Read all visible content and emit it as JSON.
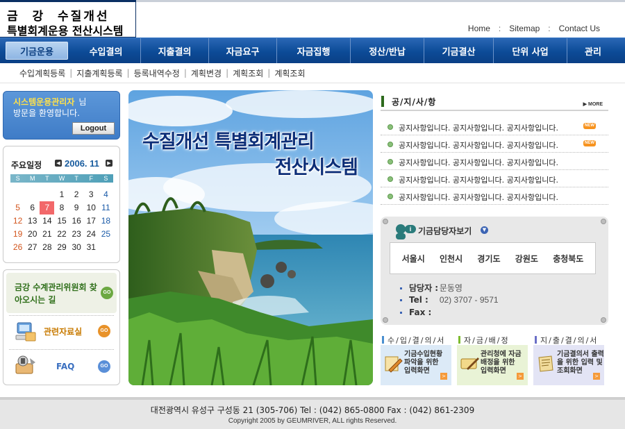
{
  "header": {
    "logo_line1": "금  강  수질개선",
    "logo_line2": "특별회계운용 전산시스템",
    "links": [
      "Home",
      "Sitemap",
      "Contact Us"
    ],
    "link_separator": ":"
  },
  "main_nav": {
    "items": [
      "기금운용",
      "수입결의",
      "지출결의",
      "자금요구",
      "자금집행",
      "정산/반납",
      "기금결산",
      "단위 사업",
      "관리"
    ],
    "active": "기금운용"
  },
  "sub_nav": {
    "items": [
      "수입계획등록",
      "지출계획등록",
      "등록내역수정",
      "계획변경",
      "계획조회",
      "계획조회"
    ],
    "separator": "|"
  },
  "login": {
    "user_name": "시스템운용관리자",
    "suffix": "님",
    "greeting": "방문을 환영합니다.",
    "logout_label": "Logout"
  },
  "calendar": {
    "title": "주요일정",
    "month": "2006. 11",
    "weekdays": [
      "S",
      "M",
      "T",
      "W",
      "T",
      "F",
      "S"
    ],
    "weeks": [
      [
        "",
        "",
        "",
        "1",
        "2",
        "3",
        "4"
      ],
      [
        "5",
        "6",
        "7",
        "8",
        "9",
        "10",
        "11"
      ],
      [
        "12",
        "13",
        "14",
        "15",
        "16",
        "17",
        "18"
      ],
      [
        "19",
        "20",
        "21",
        "22",
        "23",
        "24",
        "25"
      ],
      [
        "26",
        "27",
        "28",
        "29",
        "30",
        "31",
        ""
      ]
    ],
    "today": "7"
  },
  "left_links": {
    "directions": "금강 수계관리위원회 찾아오시는 길",
    "resources": "관련자료실",
    "faq": "FAQ",
    "go_label": "GO"
  },
  "hero": {
    "title_line1": "수질개선 특별회계관리",
    "title_line2": "전산시스템"
  },
  "notice": {
    "title": "공/지/사/항",
    "more_label": "MORE",
    "new_label": "NEW",
    "items": [
      {
        "text": "공지사항입니다. 공지사항입니다. 공지사항입니다.",
        "is_new": true
      },
      {
        "text": "공지사항입니다. 공지사항입니다. 공지사항입니다.",
        "is_new": true
      },
      {
        "text": "공지사항입니다. 공지사항입니다. 공지사항입니다.",
        "is_new": false
      },
      {
        "text": "공지사항입니다. 공지사항입니다. 공지사항입니다.",
        "is_new": false
      },
      {
        "text": "공지사항입니다. 공지사항입니다. 공지사항입니다.",
        "is_new": false
      }
    ]
  },
  "manager": {
    "title": "기금담당자보기",
    "regions": [
      "서울시",
      "인천시",
      "경기도",
      "강원도",
      "충청북도"
    ],
    "name_label": "담당자 :",
    "name_value": "문동영",
    "tel_label": "Tel :",
    "tel_value": "02) 3707 - 9571",
    "fax_label": "Fax :",
    "fax_value": ""
  },
  "quick_boxes": [
    {
      "title": "수/입/결/의/서",
      "line1": "기금수입현황",
      "line2": "파악을 위한",
      "line3": "입력화면",
      "color": "#4a8fd0",
      "bg": "#dceaf7"
    },
    {
      "title": "자/금/배/정",
      "line1": "관리청에 자금",
      "line2": "배정을 위한",
      "line3": "입력화면",
      "color": "#7dbb2e",
      "bg": "#e9f3d6"
    },
    {
      "title": "지/출/결/의/서",
      "line1": "기금결의서 출력",
      "line2": "을 위한 입력 및",
      "line3": "조회화면",
      "color": "#6a6fc7",
      "bg": "#e3e4f5"
    }
  ],
  "footer": {
    "address": "대전광역시 유성구 구성동 21 (305-706) Tel : (042) 865-0800  Fax : (042) 861-2309",
    "copyright": "Copyright 2005 by GEUMRIVER, ALL rights Reserved."
  },
  "colors": {
    "nav_blue": "#0c4b97",
    "login_blue": "#3f7cc7",
    "notice_green": "#2d6a1d"
  }
}
